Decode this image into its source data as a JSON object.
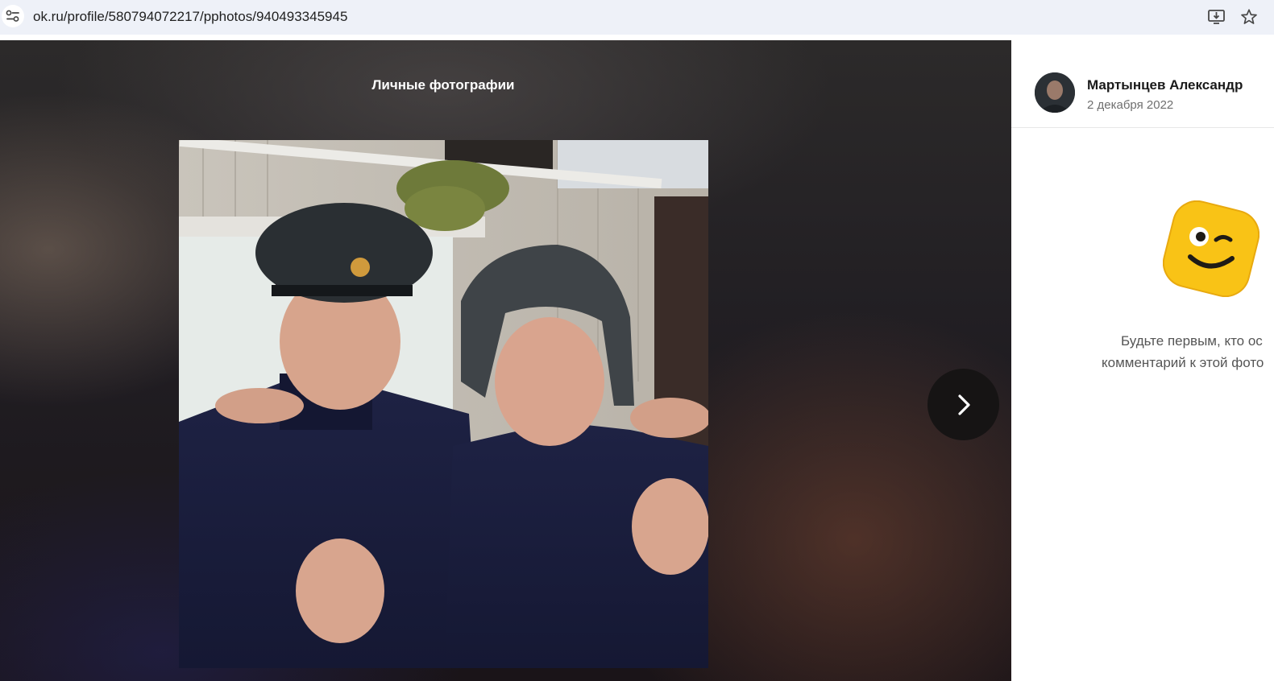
{
  "browser": {
    "url": "ok.ru/profile/580794072217/pphotos/940493345945",
    "icons": [
      "site-info-icon",
      "install-app-icon",
      "bookmark-star-icon"
    ]
  },
  "viewer": {
    "album_title": "Личные фотографии",
    "next_icon": "chevron-right-icon"
  },
  "panel": {
    "author_name": "Мартынцев Александр",
    "date": "2 декабря 2022",
    "empty_line1": "Будьте первым, кто ос",
    "empty_line2": "комментарий к этой фото"
  },
  "colors": {
    "address_bar": "#eef1f8",
    "viewer_bg": "#201d22",
    "next_button": "#161414",
    "emoji_yellow": "#f9c316"
  }
}
